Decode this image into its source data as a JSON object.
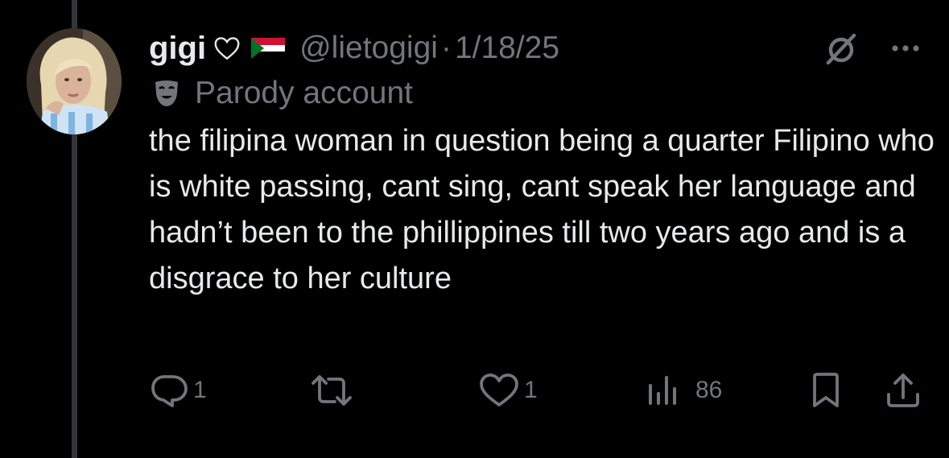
{
  "post": {
    "display_name": "gigi",
    "handle": "@lietogigi",
    "separator": "·",
    "date": "1/18/25",
    "label_icon": "parody-mask-icon",
    "label_text": "Parody account",
    "text": "the filipina woman in question being a quarter Filipino who is white passing, cant sing, cant speak her language and hadn’t been to the phillippines till two years ago and is a disgrace to her culture"
  },
  "actions": {
    "replies": "1",
    "reposts": "",
    "likes": "1",
    "views": "86"
  },
  "colors": {
    "background": "#000000",
    "text_primary": "#e7e9ea",
    "text_secondary": "#71767b",
    "thread_line": "#333639"
  }
}
